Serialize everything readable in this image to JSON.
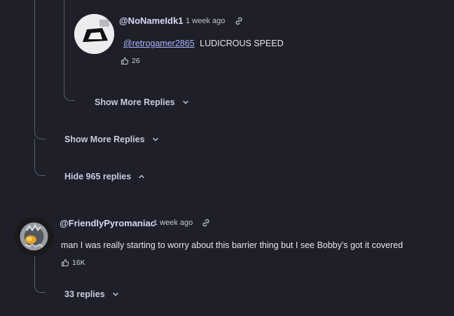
{
  "reply": {
    "author": "@NoNameIdk1",
    "timestamp": "1 week ago",
    "mention": "@retrogamer2865",
    "text": "LUDICROUS SPEED",
    "likes": "26"
  },
  "nested_show_more_label": "Show More Replies",
  "show_more_label": "Show More Replies",
  "hide_replies_label": "Hide 965 replies",
  "comment": {
    "author": "@FriendlyPyromaniac",
    "timestamp": "1 week ago",
    "text": "man I was really starting to worry about this barrier thing but I see Bobby's got it covered",
    "likes": "16K"
  },
  "replies_toggle_label": "33 replies",
  "icons": {
    "link": "link-icon",
    "like": "thumbs-up-icon",
    "expand": "chevron-down-icon",
    "collapse": "chevron-up-icon"
  },
  "colors": {
    "background": "#1e1f29",
    "author": "#d7d9f2",
    "mention": "#a9b6ff",
    "thread_line": "#5a5c6a"
  }
}
